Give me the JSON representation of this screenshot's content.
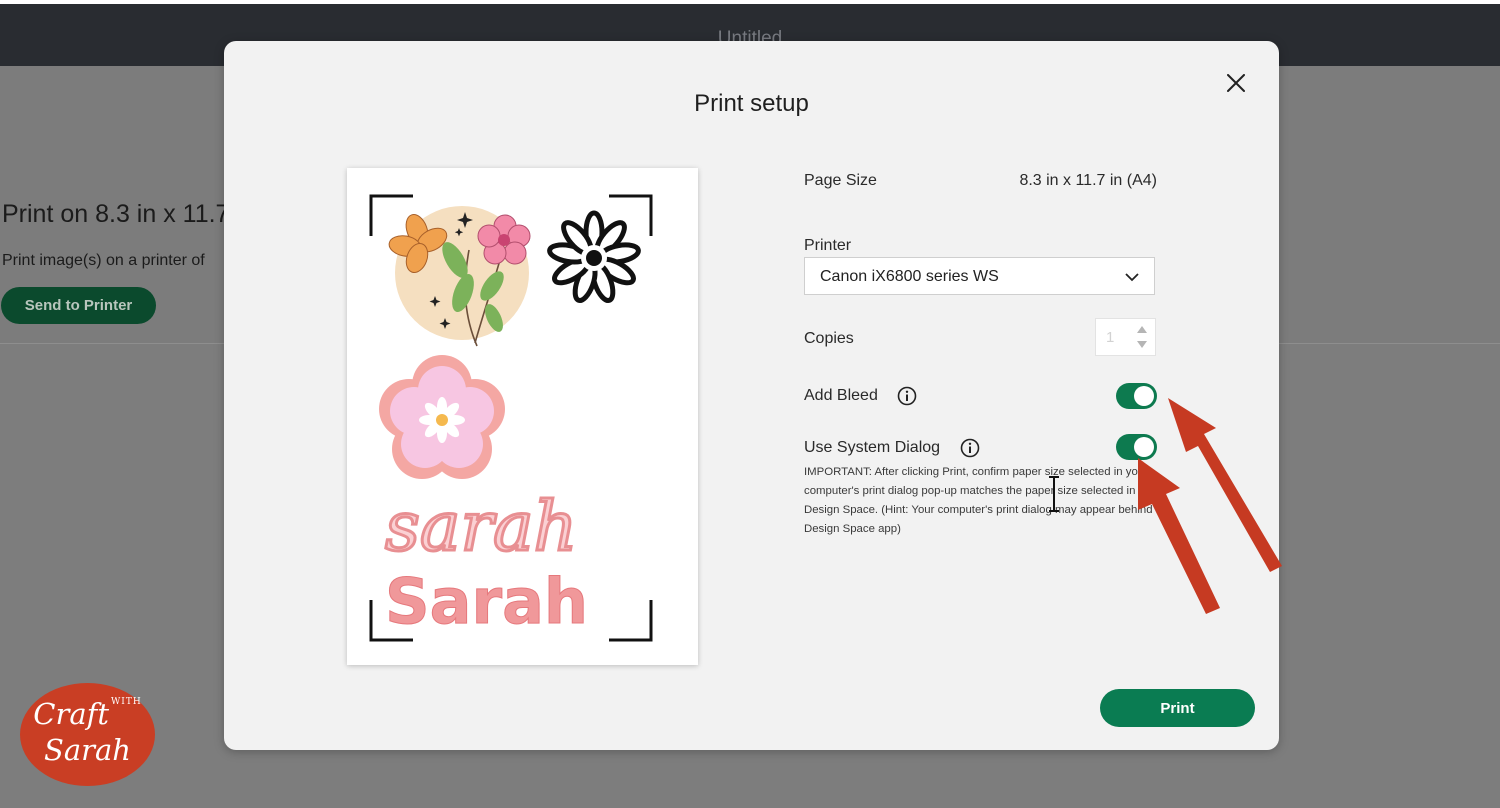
{
  "app": {
    "window_title": "Untitled"
  },
  "background": {
    "print_title": "Print on 8.3 in x 11.7",
    "print_subtitle": "Print image(s) on a printer of",
    "send_button": "Send to Printer"
  },
  "modal": {
    "title": "Print setup",
    "page_size_label": "Page Size",
    "page_size_value": "8.3 in x 11.7 in (A4)",
    "printer_label": "Printer",
    "printer_value": "Canon iX6800 series WS",
    "copies_label": "Copies",
    "copies_value": "1",
    "add_bleed_label": "Add Bleed",
    "add_bleed_on": true,
    "system_dialog_label": "Use System Dialog",
    "system_dialog_on": true,
    "note": "IMPORTANT: After clicking Print, confirm paper size selected in your computer's print dialog pop-up matches the paper size selected in Design Space. (Hint: Your computer's print dialog may appear behind Design Space app)",
    "print_button": "Print"
  },
  "preview": {
    "text_script": "sarah",
    "text_block": "Sarah"
  },
  "watermark": {
    "line1": "Craft",
    "with": "WITH",
    "line2": "Sarah"
  },
  "colors": {
    "accent": "#0a7c52",
    "toggle_on": "#0d7a4f",
    "annotation_arrow": "#c63a22",
    "logo": "#c93e24"
  }
}
